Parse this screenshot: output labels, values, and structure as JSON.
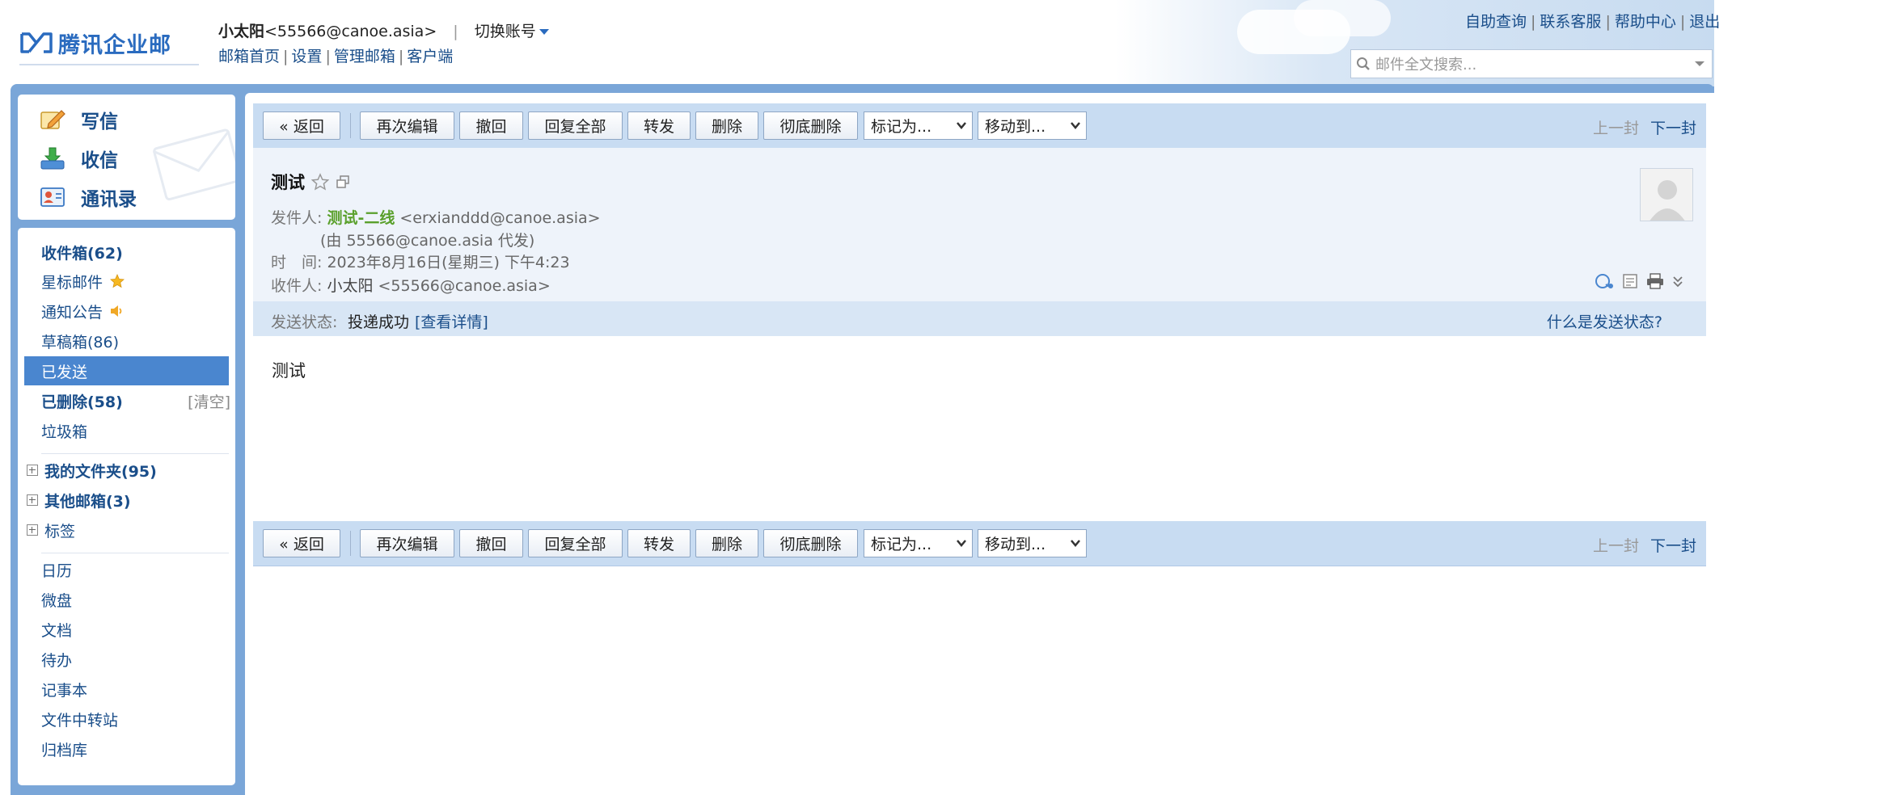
{
  "app": {
    "logo_text": "腾讯企业邮"
  },
  "user": {
    "name": "小太阳",
    "email": "<55566@canoe.asia>",
    "switch_label": "切换账号"
  },
  "nav_links": [
    "邮箱首页",
    "设置",
    "管理邮箱",
    "客户端"
  ],
  "top_links": [
    "自助查询",
    "联系客服",
    "帮助中心",
    "退出"
  ],
  "search": {
    "placeholder": "邮件全文搜索..."
  },
  "quick": {
    "compose": "写信",
    "receive": "收信",
    "contacts": "通讯录"
  },
  "folders": {
    "inbox": "收件箱(62)",
    "starred": "星标邮件",
    "notice": "通知公告",
    "drafts": "草稿箱(86)",
    "sent": "已发送",
    "deleted": "已删除(58)",
    "clear": "[清空]",
    "spam": "垃圾箱",
    "my_folders": "我的文件夹(95)",
    "other_mailboxes": "其他邮箱(3)",
    "tags": "标签",
    "apps": [
      "日历",
      "微盘",
      "文档",
      "待办",
      "记事本",
      "文件中转站",
      "归档库"
    ]
  },
  "toolbar": {
    "back": "« 返回",
    "reedit": "再次编辑",
    "recall": "撤回",
    "reply_all": "回复全部",
    "forward": "转发",
    "delete": "删除",
    "delete_perm": "彻底删除",
    "mark_as": "标记为...",
    "move_to": "移动到...",
    "prev": "上一封",
    "next": "下一封"
  },
  "mail": {
    "subject": "测试",
    "from_label": "发件人:",
    "from_name": "测试-二线",
    "from_addr": "<erxianddd@canoe.asia>",
    "on_behalf": "(由 55566@canoe.asia 代发)",
    "time_label": "时　间:",
    "time": "2023年8月16日(星期三) 下午4:23",
    "to_label": "收件人:",
    "to_name": "小太阳",
    "to_addr": "<55566@canoe.asia>",
    "status_label": "发送状态:",
    "status": "投递成功",
    "status_link": "[查看详情]",
    "status_help": "什么是发送状态?",
    "body": "测试"
  },
  "colors": {
    "frame": "#7aa6d8",
    "toolbar": "#c8dcf2",
    "active_folder": "#4a86cf",
    "link": "#1a4e8a",
    "sender": "#5aa02c"
  }
}
